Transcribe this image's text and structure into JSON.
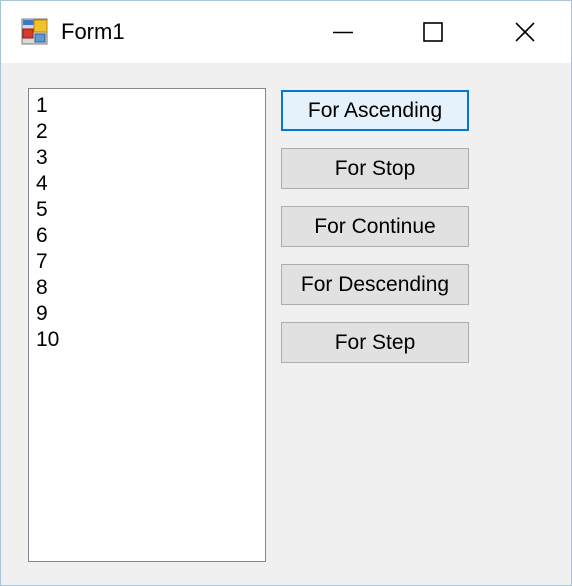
{
  "window": {
    "title": "Form1",
    "app_icon": "form-app-icon",
    "controls": {
      "minimize_icon": "minimize-icon",
      "maximize_icon": "maximize-icon",
      "close_icon": "close-icon"
    }
  },
  "listbox": {
    "items": [
      "1",
      "2",
      "3",
      "4",
      "5",
      "6",
      "7",
      "8",
      "9",
      "10"
    ]
  },
  "buttons": {
    "ascending": "For Ascending",
    "stop": "For Stop",
    "continue": "For Continue",
    "descending": "For Descending",
    "step": "For Step"
  },
  "colors": {
    "accent": "#0078d7",
    "button_face": "#e1e1e1",
    "form_background": "#f0f0f0"
  }
}
